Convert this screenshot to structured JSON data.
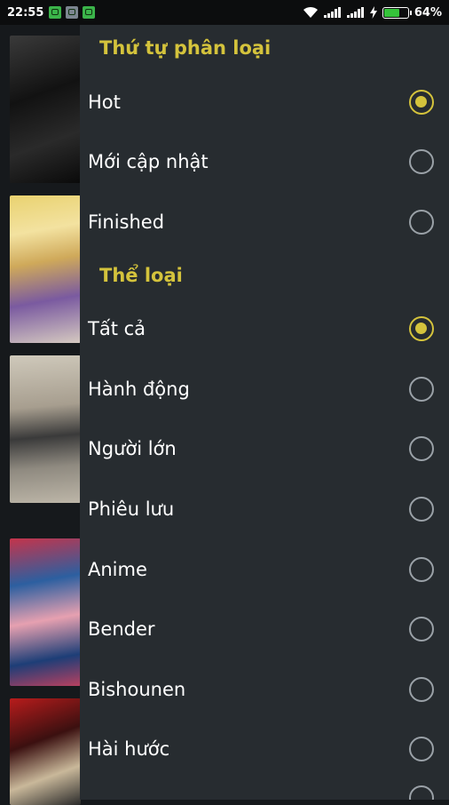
{
  "status_bar": {
    "time": "22:55",
    "battery": "64%",
    "battery_level": 0.64,
    "notification_icons": [
      "android-icon",
      "android-icon-grey",
      "android-icon"
    ]
  },
  "drawer": {
    "accent_color": "#d4c33c",
    "sort_section": {
      "title": "Thứ tự phân loại",
      "options": [
        {
          "label": "Hot",
          "checked": true
        },
        {
          "label": "Mới cập nhật",
          "checked": false
        },
        {
          "label": "Finished",
          "checked": false
        }
      ]
    },
    "genre_section": {
      "title": "Thể loại",
      "options": [
        {
          "label": "Tất cả",
          "checked": true
        },
        {
          "label": "Hành động",
          "checked": false
        },
        {
          "label": "Người lớn",
          "checked": false
        },
        {
          "label": "Phiêu lưu",
          "checked": false
        },
        {
          "label": "Anime",
          "checked": false
        },
        {
          "label": "Bender",
          "checked": false
        },
        {
          "label": "Bishounen",
          "checked": false
        },
        {
          "label": "Hài hước",
          "checked": false
        }
      ]
    }
  }
}
